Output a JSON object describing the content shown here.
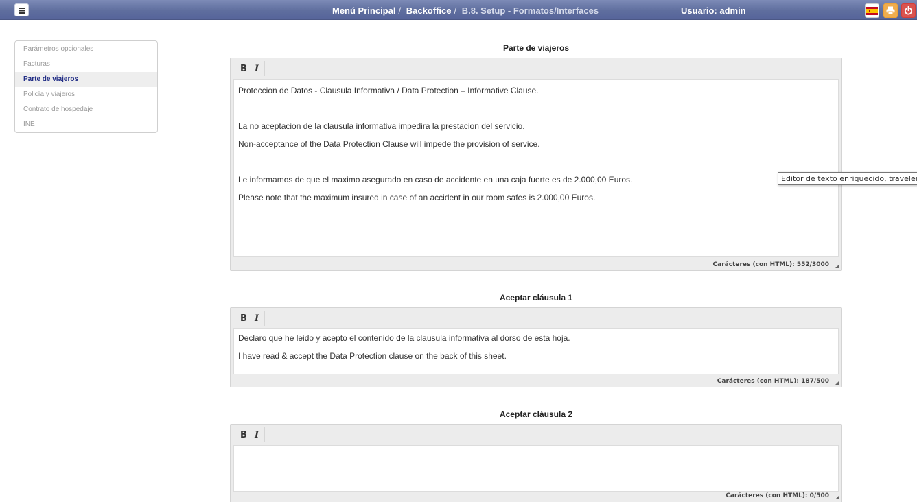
{
  "header": {
    "breadcrumb": [
      "Menú Principal",
      "Backoffice",
      "B.8. Setup - Formatos/Interfaces"
    ],
    "user_label": "Usuario: admin",
    "icons": [
      "menu-icon",
      "spain-flag-icon",
      "print-icon",
      "power-icon"
    ],
    "colors": {
      "print": "#f0ad4e",
      "power": "#d9534f",
      "bar": "#5f6e9e"
    }
  },
  "sidebar": {
    "items": [
      {
        "label": "Parámetros opcionales"
      },
      {
        "label": "Facturas"
      },
      {
        "label": "Parte de viajeros",
        "active": true
      },
      {
        "label": "Policía y viajeros"
      },
      {
        "label": "Contrato de hospedaje"
      },
      {
        "label": "INE"
      }
    ]
  },
  "editors": [
    {
      "title": "Parte de viajeros",
      "toolbar": {
        "bold": "B",
        "italic": "I"
      },
      "lines": [
        "Proteccion de Datos - Clausula Informativa / Data Protection – Informative Clause.",
        "",
        "La no aceptacion de la clausula informativa impedira la prestacion del servicio.",
        "Non-acceptance of the Data Protection Clause will impede the provision of service.",
        "",
        "Le informamos de que el maximo asegurado en caso de accidente en una caja fuerte es de 2.000,00 Euros.",
        "Please note that the maximum insured in case of an accident in our room safes is 2.000,00 Euros."
      ],
      "counter": "Carácteres (con HTML): 552/3000"
    },
    {
      "title": "Aceptar cláusula 1",
      "toolbar": {
        "bold": "B",
        "italic": "I"
      },
      "lines": [
        "Declaro que he leido y acepto el contenido de la clausula informativa al dorso de esta hoja.",
        "I have read & accept the Data Protection clause on the back of this sheet."
      ],
      "counter": "Carácteres (con HTML): 187/500"
    },
    {
      "title": "Aceptar cláusula 2",
      "toolbar": {
        "bold": "B",
        "italic": "I"
      },
      "lines": [],
      "counter": "Carácteres (con HTML): 0/500"
    }
  ],
  "tooltip": "Editor de texto enriquecido, travelersRepor"
}
